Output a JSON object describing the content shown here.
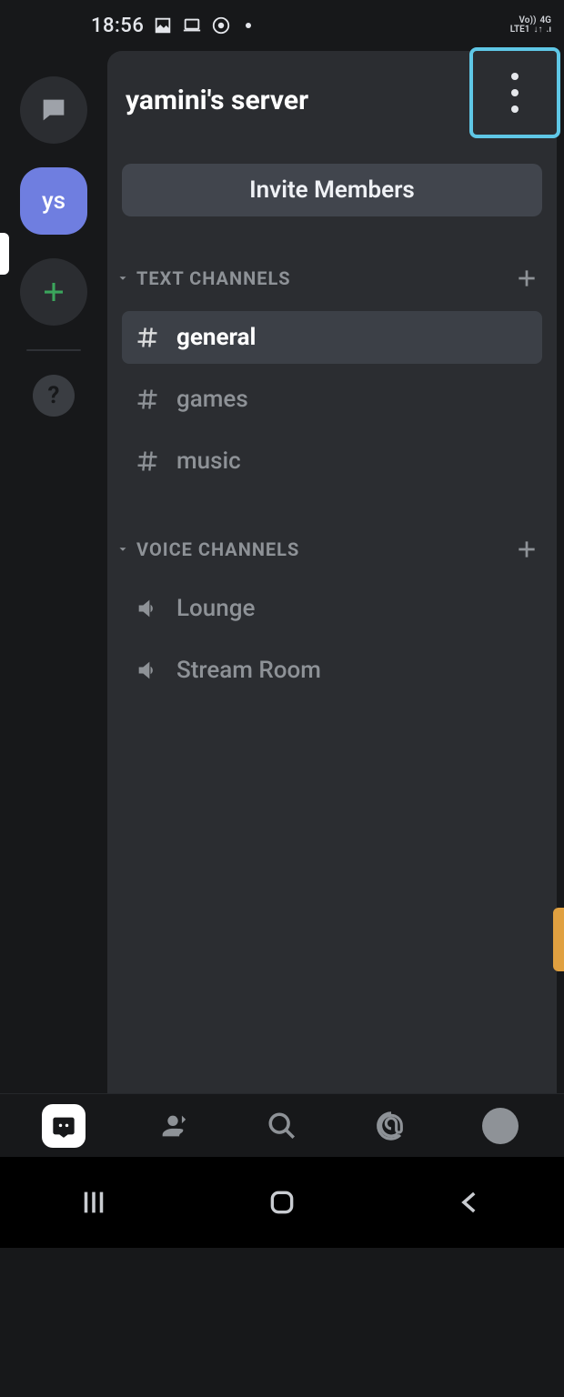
{
  "status": {
    "time": "18:56",
    "volte": "Vo))",
    "lte": "LTE1",
    "net": "4G"
  },
  "rail": {
    "server_initials": "ys"
  },
  "panel": {
    "title": "yamini's server",
    "invite_label": "Invite Members"
  },
  "text_channels": {
    "heading": "TEXT CHANNELS",
    "items": [
      {
        "label": "general",
        "active": true
      },
      {
        "label": "games",
        "active": false
      },
      {
        "label": "music",
        "active": false
      }
    ]
  },
  "voice_channels": {
    "heading": "VOICE CHANNELS",
    "items": [
      {
        "label": "Lounge"
      },
      {
        "label": "Stream Room"
      }
    ]
  }
}
